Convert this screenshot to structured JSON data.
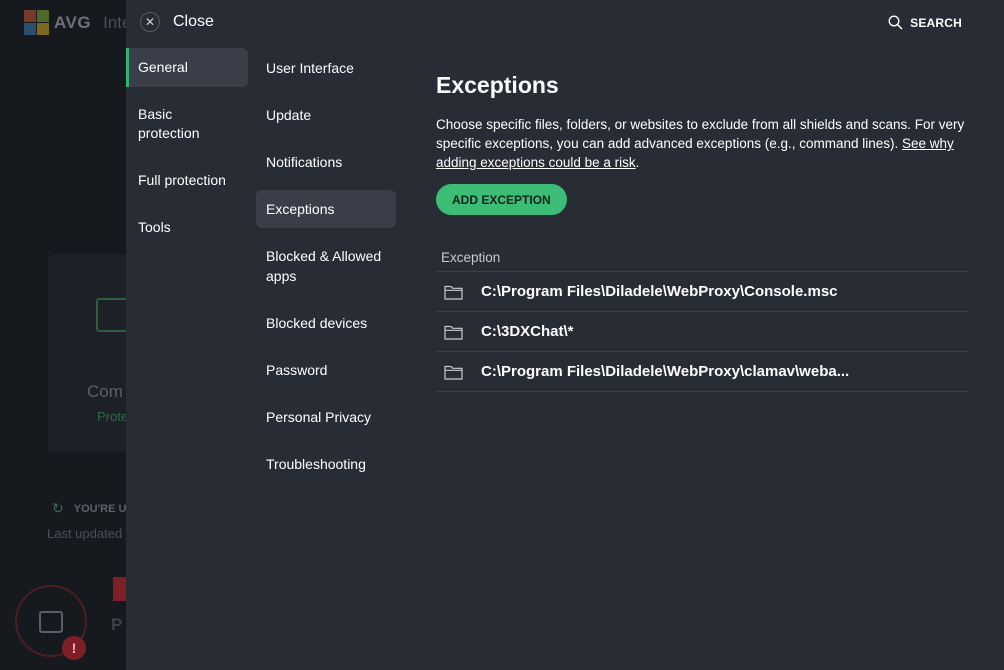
{
  "background": {
    "logo_text": "AVG",
    "logo_sub": "Inte",
    "card": {
      "title": "Com",
      "status": "Prote"
    },
    "update": {
      "title": "YOU'RE U",
      "sub": "Last updated"
    },
    "bottom_letter": "P",
    "alert": "!"
  },
  "header": {
    "close_label": "Close",
    "search_label": "SEARCH"
  },
  "nav_main": {
    "items": [
      {
        "label": "General"
      },
      {
        "label": "Basic protection"
      },
      {
        "label": "Full protection"
      },
      {
        "label": "Tools"
      }
    ]
  },
  "nav_sub": {
    "items": [
      {
        "label": "User Interface"
      },
      {
        "label": "Update"
      },
      {
        "label": "Notifications"
      },
      {
        "label": "Exceptions"
      },
      {
        "label": "Blocked & Allowed apps"
      },
      {
        "label": "Blocked devices"
      },
      {
        "label": "Password"
      },
      {
        "label": "Personal Privacy"
      },
      {
        "label": "Troubleshooting"
      }
    ]
  },
  "content": {
    "title": "Exceptions",
    "description": "Choose specific files, folders, or websites to exclude from all shields and scans. For very specific exceptions, you can add advanced exceptions (e.g., command lines).",
    "risk_link": "See why adding exceptions could be a risk",
    "risk_suffix": ".",
    "add_button": "ADD EXCEPTION",
    "table_header": "Exception",
    "rows": [
      {
        "path": "C:\\Program Files\\Diladele\\WebProxy\\Console.msc",
        "icon": "folder-icon"
      },
      {
        "path": "C:\\3DXChat\\*",
        "icon": "folder-icon"
      },
      {
        "path": "C:\\Program Files\\Diladele\\WebProxy\\clamav\\weba...",
        "icon": "folder-icon"
      }
    ]
  },
  "colors": {
    "panel_bg": "#272c35",
    "accent_green": "#3bbd76",
    "active_item_bg": "#393e48"
  }
}
